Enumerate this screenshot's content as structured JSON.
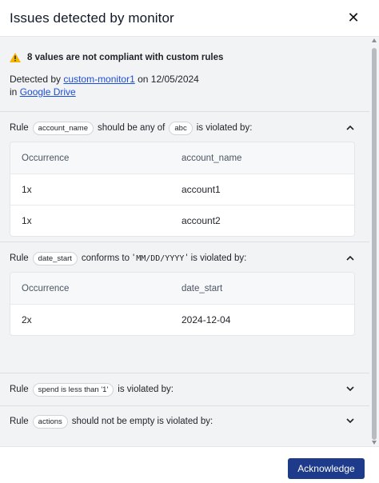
{
  "dialog": {
    "title": "Issues detected by monitor",
    "close_label": "✕"
  },
  "alert": {
    "title": "8 values are not compliant with custom rules",
    "detected_prefix": "Detected by",
    "monitor_name": "custom-monitor1",
    "date_text": "on 12/05/2024",
    "in_prefix": "in",
    "source_name": "Google Drive"
  },
  "rules": [
    {
      "prefix": "Rule",
      "field": "account_name",
      "condition": "should be any of",
      "value": "abc",
      "suffix": "is violated by:",
      "expanded": true,
      "table": {
        "headers": [
          "Occurrence",
          "account_name"
        ],
        "rows": [
          [
            "1x",
            "account1"
          ],
          [
            "1x",
            "account2"
          ]
        ]
      }
    },
    {
      "prefix": "Rule",
      "field": "date_start",
      "condition": "conforms to",
      "quote_open": "'",
      "value": "MM/DD/YYYY",
      "quote_close": "'",
      "suffix": "is violated by:",
      "expanded": true,
      "table": {
        "headers": [
          "Occurrence",
          "date_start"
        ],
        "rows": [
          [
            "2x",
            "2024-12-04"
          ]
        ]
      }
    },
    {
      "prefix": "Rule",
      "field": "spend is less than '1'",
      "suffix": "is violated by:",
      "expanded": false
    },
    {
      "prefix": "Rule",
      "field": "actions",
      "suffix": "should not be empty is violated by:",
      "expanded": false
    }
  ],
  "footer": {
    "acknowledge_label": "Acknowledge"
  },
  "colors": {
    "accent": "#1e3a8a",
    "link": "#1d4ed8",
    "warning": "#f59e0b"
  },
  "icons": {
    "close": "close-icon",
    "warning": "warning-icon",
    "collapse": "chevron-up-icon",
    "expand": "chevron-down-icon"
  }
}
